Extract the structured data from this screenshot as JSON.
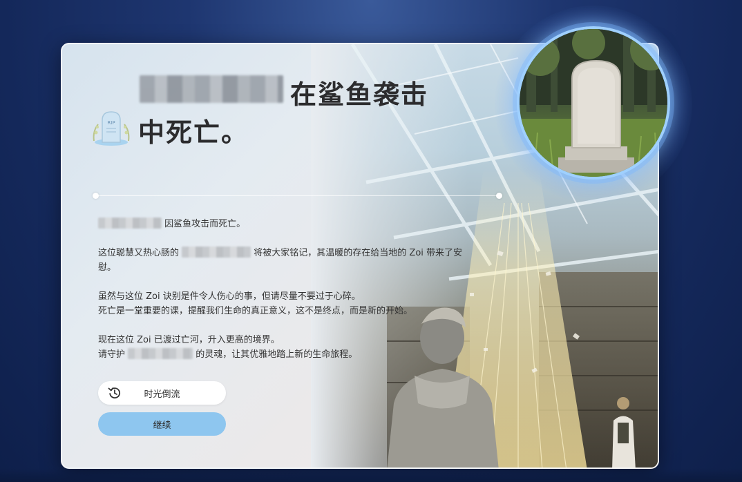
{
  "title": {
    "line1_suffix": "在鲨鱼袭击",
    "line2": "中死亡。"
  },
  "rip_icon": {
    "label": "RIP"
  },
  "body": {
    "p1_suffix": "因鲨鱼攻击而死亡。",
    "p2_prefix": "这位聪慧又热心肠的",
    "p2_suffix": "将被大家铭记，其温暖的存在给当地的 Zoi 带来了安",
    "p2_cont": "慰。",
    "p3_line1": "虽然与这位 Zoi 诀别是件令人伤心的事，但请尽量不要过于心碎。",
    "p3_line2": "死亡是一堂重要的课，提醒我们生命的真正意义，这不是终点，而是新的开始。",
    "p4_line1": "现在这位 Zoi 已渡过亡河，升入更高的境界。",
    "p4_line2_prefix": "请守护",
    "p4_line2_suffix": "的灵魂，让其优雅地踏上新的生命旅程。"
  },
  "buttons": {
    "rewind_label": "时光倒流",
    "continue_label": "继续"
  },
  "colors": {
    "continue_button": "#8ec6ef",
    "portrait_ring": "#9fd0ff",
    "background": "#1e3670"
  }
}
